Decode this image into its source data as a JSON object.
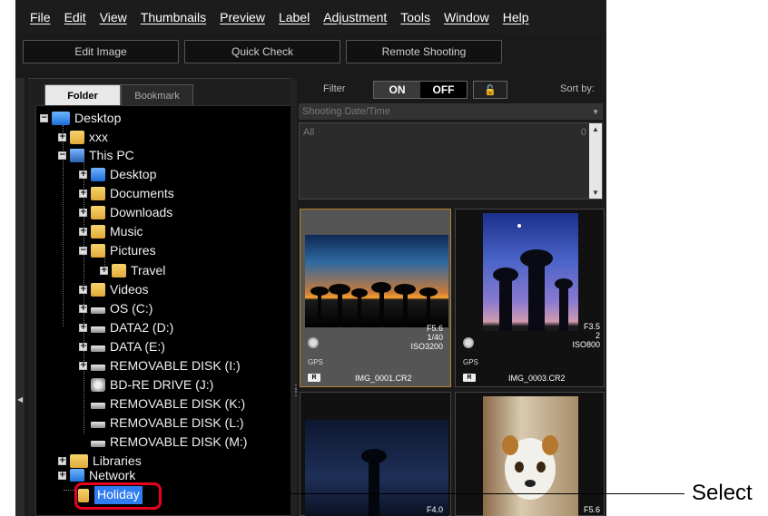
{
  "menu": [
    "File",
    "Edit",
    "View",
    "Thumbnails",
    "Preview",
    "Label",
    "Adjustment",
    "Tools",
    "Window",
    "Help"
  ],
  "toolbar": {
    "edit_image": "Edit Image",
    "quick_check": "Quick Check",
    "remote_shooting": "Remote Shooting"
  },
  "tabs": {
    "folder": "Folder",
    "bookmark": "Bookmark"
  },
  "tree": {
    "desktop_root": "Desktop",
    "xxx": "xxx",
    "this_pc": "This PC",
    "desktop": "Desktop",
    "documents": "Documents",
    "downloads": "Downloads",
    "music": "Music",
    "pictures": "Pictures",
    "travel": "Travel",
    "videos": "Videos",
    "os_c": "OS (C:)",
    "data2": "DATA2 (D:)",
    "data_e": "DATA (E:)",
    "removable_i": "REMOVABLE DISK (I:)",
    "bd_re": "BD-RE DRIVE (J:)",
    "removable_k": "REMOVABLE DISK (K:)",
    "removable_l": "REMOVABLE DISK (L:)",
    "removable_m": "REMOVABLE DISK (M:)",
    "libraries": "Libraries",
    "network": "Network",
    "holiday": "Holiday"
  },
  "filter": {
    "label": "Filter",
    "on": "ON",
    "off": "OFF",
    "sort_by": "Sort by:",
    "date_field": "Shooting Date/Time",
    "list_all": "All",
    "list_count": "0"
  },
  "thumbnails": [
    {
      "aperture": "F5.6",
      "shutter": "1/40",
      "iso": "ISO3200",
      "gps": "GPS",
      "raw": "R",
      "file": "IMG_0001.CR2"
    },
    {
      "aperture": "F3.5",
      "shutter": "2",
      "iso": "ISO800",
      "gps": "GPS",
      "raw": "R",
      "file": "IMG_0003.CR2"
    },
    {
      "aperture": "F4.0"
    },
    {
      "aperture": "F5.6"
    }
  ],
  "annotation": {
    "callout": "Select"
  },
  "colors": {
    "selection_ring": "#e8001c",
    "tree_selection": "#2f7df2",
    "thumb_selected_border": "#b8802a"
  }
}
